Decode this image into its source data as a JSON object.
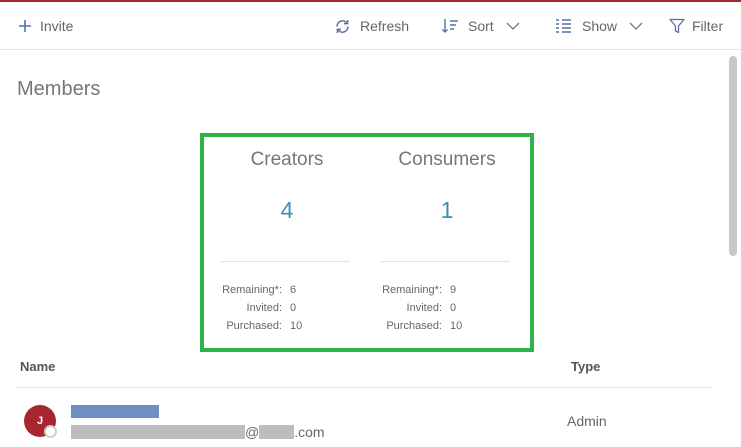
{
  "toolbar": {
    "invite_label": "Invite",
    "refresh_label": "Refresh",
    "sort_label": "Sort",
    "show_label": "Show",
    "filter_label": "Filter"
  },
  "page": {
    "title": "Members"
  },
  "stats": {
    "creators": {
      "title": "Creators",
      "count": "4",
      "remaining_label": "Remaining*:",
      "remaining": "6",
      "invited_label": "Invited:",
      "invited": "0",
      "purchased_label": "Purchased:",
      "purchased": "10"
    },
    "consumers": {
      "title": "Consumers",
      "count": "1",
      "remaining_label": "Remaining*:",
      "remaining": "9",
      "invited_label": "Invited:",
      "invited": "0",
      "purchased_label": "Purchased:",
      "purchased": "10"
    },
    "highlight_color": "#2db34a"
  },
  "table": {
    "headers": {
      "name": "Name",
      "type": "Type"
    },
    "rows": [
      {
        "initial": "J",
        "email_at": "@",
        "email_tld": ".com",
        "type": "Admin"
      }
    ]
  },
  "colors": {
    "accent": "#a3262c",
    "count": "#3d8fb4",
    "avatar": "#a8262d"
  }
}
